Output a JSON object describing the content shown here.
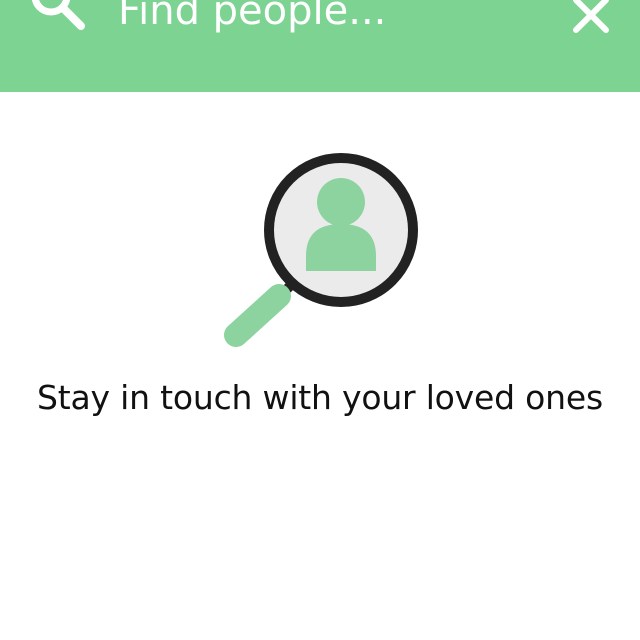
{
  "colors": {
    "header_background": "#7dd392",
    "accent_green": "#7dd392",
    "lens_background": "#ebebeb",
    "frame_dark": "#222222",
    "text": "#111111"
  },
  "search": {
    "placeholder": "Find people...",
    "value": "",
    "search_icon": "search-icon",
    "close_icon": "close-icon"
  },
  "empty_state": {
    "illustration_icon": "magnifier-person-icon",
    "message": "Stay in touch with your loved ones"
  }
}
